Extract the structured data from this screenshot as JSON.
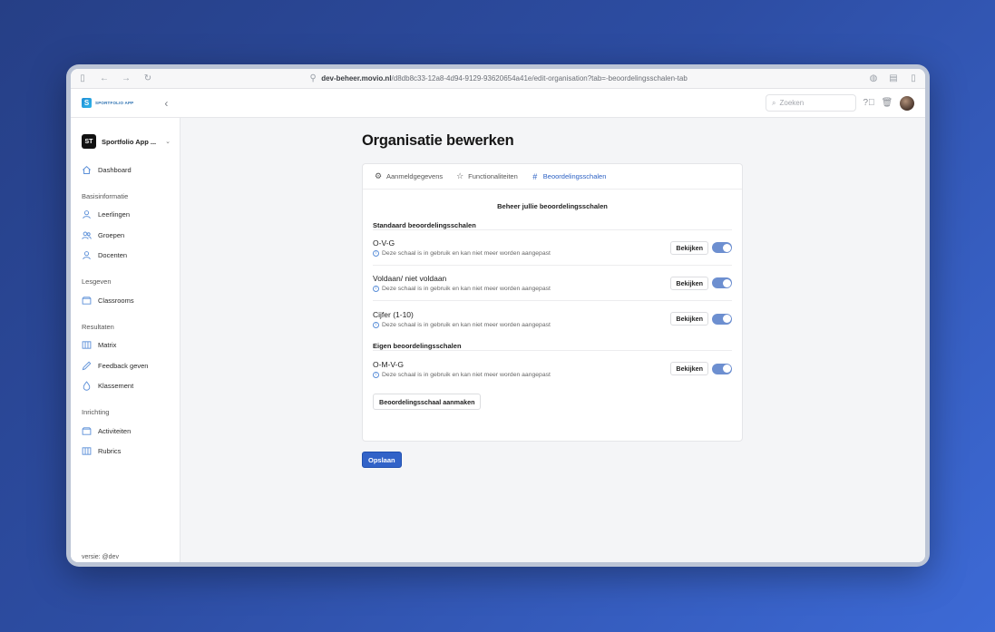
{
  "browser": {
    "url_host": "dev-beheer.movio.nl",
    "url_path": "/d8db8c33-12a8-4d94-9129-93620654a41e/edit-organisation?tab=-beoordelingsschalen-tab"
  },
  "app": {
    "logo_text": "SPORTFOLIO APP",
    "search_placeholder": "Zoeken"
  },
  "sidebar": {
    "org_initials": "ST",
    "org_name": "Sportfolio App ...",
    "dashboard": "Dashboard",
    "sections": [
      {
        "title": "Basisinformatie",
        "items": [
          "Leerlingen",
          "Groepen",
          "Docenten"
        ]
      },
      {
        "title": "Lesgeven",
        "items": [
          "Classrooms"
        ]
      },
      {
        "title": "Resultaten",
        "items": [
          "Matrix",
          "Feedback geven",
          "Klassement"
        ]
      },
      {
        "title": "Inrichting",
        "items": [
          "Activiteiten",
          "Rubrics"
        ]
      }
    ],
    "version": "versie: @dev"
  },
  "page": {
    "title": "Organisatie bewerken",
    "tabs": [
      "Aanmeldgegevens",
      "Functionaliteiten",
      "Beoordelingsschalen"
    ],
    "active_tab": "Beoordelingsschalen",
    "card_heading": "Beheer jullie beoordelingsschalen",
    "standard_title": "Standaard beoordelingsschalen",
    "standard_scales": [
      {
        "name": "O-V-G",
        "note": "Deze schaal is in gebruik en kan niet meer worden aangepast",
        "enabled": true
      },
      {
        "name": "Voldaan/ niet voldaan",
        "note": "Deze schaal is in gebruik en kan niet meer worden aangepast",
        "enabled": true
      },
      {
        "name": "Cijfer (1-10)",
        "note": "Deze schaal is in gebruik en kan niet meer worden aangepast",
        "enabled": true
      }
    ],
    "own_title": "Eigen beoordelingsschalen",
    "own_scales": [
      {
        "name": "O-M-V-G",
        "note": "Deze schaal is in gebruik en kan niet meer worden aangepast",
        "enabled": true
      }
    ],
    "view_label": "Bekijken",
    "create_label": "Beoordelingsschaal aanmaken",
    "save_label": "Opslaan"
  },
  "colors": {
    "accent": "#3263c8",
    "toggle_on": "#6d8fd0",
    "icon_blue": "#5b8fd8"
  }
}
